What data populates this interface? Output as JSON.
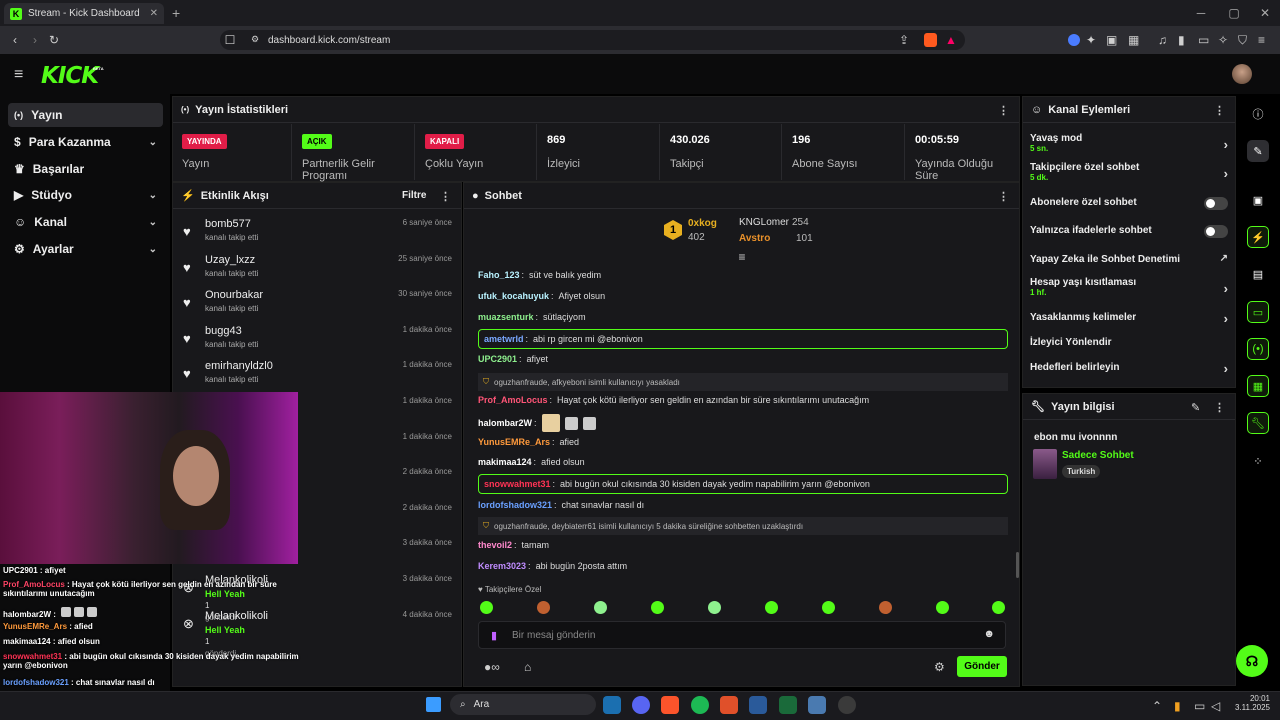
{
  "browser": {
    "tab_title": "Stream - Kick Dashboard",
    "url": "dashboard.kick.com/stream",
    "new_tab": "+"
  },
  "brand": {
    "logo": "KICK",
    "beta": "BETA",
    "accent": "#53fc18"
  },
  "sidebar": {
    "items": [
      {
        "label": "Yayın",
        "icon": "broadcast-icon",
        "active": true
      },
      {
        "label": "Para Kazanma",
        "icon": "dollar-icon",
        "chevron": true
      },
      {
        "label": "Başarılar",
        "icon": "trophy-icon"
      },
      {
        "label": "Stüdyo",
        "icon": "video-icon",
        "chevron": true
      },
      {
        "label": "Kanal",
        "icon": "users-icon",
        "chevron": true
      },
      {
        "label": "Ayarlar",
        "icon": "gear-icon",
        "chevron": true
      }
    ]
  },
  "stats": {
    "title": "Yayın İstatistikleri",
    "items": [
      {
        "value": "YAYINDA",
        "label": "Yayın",
        "badge_color": "#e11d48"
      },
      {
        "value": "AÇIK",
        "label": "Partnerlik Gelir Programı",
        "badge_color": "#53fc18"
      },
      {
        "value": "KAPALI",
        "label": "Çoklu Yayın",
        "badge_color": "#e11d48"
      },
      {
        "value": "869",
        "label": "İzleyici"
      },
      {
        "value": "430.026",
        "label": "Takipçi"
      },
      {
        "value": "196",
        "label": "Abone Sayısı"
      },
      {
        "value": "00:05:59",
        "label": "Yayında Olduğu Süre"
      }
    ]
  },
  "feed": {
    "title": "Etkinlik Akışı",
    "filter": "Filtre",
    "items": [
      {
        "name": "bomb577",
        "action": "kanalı takip etti",
        "time": "6 saniye önce"
      },
      {
        "name": "Uzay_lxzz",
        "action": "kanalı takip etti",
        "time": "25 saniye önce"
      },
      {
        "name": "Onourbakar",
        "action": "kanalı takip etti",
        "time": "30 saniye önce"
      },
      {
        "name": "bugg43",
        "action": "kanalı takip etti",
        "time": "1 dakika önce"
      },
      {
        "name": "emirhanyldzl0",
        "action": "kanalı takip etti",
        "time": "1 dakika önce"
      },
      {
        "name": "",
        "action": "",
        "time": "1 dakika önce"
      },
      {
        "name": "",
        "action": "",
        "time": "1 dakika önce"
      },
      {
        "name": "",
        "action": "",
        "time": "2 dakika önce"
      },
      {
        "name": "",
        "action": "",
        "time": "2 dakika önce"
      },
      {
        "name": "",
        "action": "",
        "time": "3 dakika önce"
      },
      {
        "name": "Melankolikoli",
        "action": "Hell Yeah",
        "extra": "1",
        "sent": "gönderdi",
        "time": "3 dakika önce"
      },
      {
        "name": "Melankolikoli",
        "action": "Hell Yeah",
        "extra": "1",
        "sent": "gönderdi",
        "time": "4 dakika önce"
      }
    ]
  },
  "chat": {
    "title": "Sohbet",
    "leaderboard": [
      {
        "rank": "1",
        "name": "0xkog",
        "count": "402"
      },
      {
        "name": "KNGLomer",
        "count": "254"
      },
      {
        "name": "Avstro",
        "count": "101"
      }
    ],
    "messages": [
      {
        "user": "Faho_123",
        "color": "#b9f2ff",
        "text": "süt ve balık yedim"
      },
      {
        "user": "ufuk_kocahuyuk",
        "color": "#b9f2ff",
        "text": "Afiyet olsun"
      },
      {
        "user": "muazsenturk",
        "color": "#8ef08e",
        "text": "sütlaçiyom"
      },
      {
        "user": "ametwrld",
        "color": "#7aa8ff",
        "text": "abi rp gircen mi @ebonivon",
        "highlight": true
      },
      {
        "user": "UPC2901",
        "color": "#8ef08e",
        "text": "afiyet"
      },
      {
        "system": true,
        "text": "oguzhanfraude, afkyeboni isimli kullanıcıyı yasakladı"
      },
      {
        "user": "Prof_AmoLocus",
        "color": "#ff5577",
        "text": "Hayat çok kötü ilerliyor sen geldin en azından bir süre sıkıntılarımı unutacağım"
      },
      {
        "user": "halombar2W",
        "color": "#fff",
        "text": ""
      },
      {
        "user": "YunusEMRe_Ars",
        "color": "#ff9a3c",
        "text": "afied"
      },
      {
        "user": "makimaa124",
        "color": "#fff",
        "text": "afied olsun"
      },
      {
        "user": "snowwahmet31",
        "color": "#ff3355",
        "text": "abi bugün okul cıkısında 30 kisiden dayak yedim napabilirim yarın @ebonivon",
        "highlight": true
      },
      {
        "user": "lordofshadow321",
        "color": "#6aa0ff",
        "text": "chat sınavlar nasıl dı"
      },
      {
        "system": true,
        "text": "oguzhanfraude, deybiaterr61 isimli kullanıcıyı 5 dakika süreliğine sohbetten uzaklaştırdı"
      },
      {
        "user": "thevoil2",
        "color": "#ff88cc",
        "text": "tamam"
      },
      {
        "user": "Kerem3023",
        "color": "#c08cff",
        "text": "abi bugün 2posta attım"
      }
    ],
    "follower_label": "Takipçilere Özel",
    "input_placeholder": "Bir mesaj gönderin",
    "send": "Gönder"
  },
  "channel_actions": {
    "title": "Kanal Eylemleri",
    "items": [
      {
        "label": "Yavaş mod",
        "sub": "5 sn.",
        "type": "arrow"
      },
      {
        "label": "Takipçilere özel sohbet",
        "sub": "5 dk.",
        "type": "arrow"
      },
      {
        "label": "Abonelere özel sohbet",
        "type": "toggle"
      },
      {
        "label": "Yalnızca ifadelerle sohbet",
        "type": "toggle"
      },
      {
        "label": "Yapay Zeka ile Sohbet Denetimi",
        "type": "external"
      },
      {
        "label": "Hesap yaşı kısıtlaması",
        "sub": "1 hf.",
        "type": "arrow"
      },
      {
        "label": "Yasaklanmış kelimeler",
        "type": "arrow"
      },
      {
        "label": "İzleyici Yönlendir",
        "type": "none"
      },
      {
        "label": "Hedefleri belirleyin",
        "type": "arrow"
      }
    ]
  },
  "stream_info": {
    "title": "Yayın bilgisi",
    "stream_title": "ebon mu ivonnnn",
    "category": "Sadece Sohbet",
    "language": "Turkish"
  },
  "overlay": [
    {
      "user": "UPC2901",
      "text": "afiyet",
      "color": "#ffffff"
    },
    {
      "user": "Prof_AmoLocus",
      "text": "Hayat çok kötü ilerliyor sen geldin en azından bir süre sıkıntılarımı unutacağım",
      "color": "#ff4466"
    },
    {
      "user": "halombar2W",
      "text": "",
      "color": "#ffffff"
    },
    {
      "user": "YunusEMRe_Ars",
      "text": "afied",
      "color": "#ff9a3c"
    },
    {
      "user": "makimaa124",
      "text": "afied olsun",
      "color": "#ffffff"
    },
    {
      "user": "snowwahmet31",
      "text": "abi bugün okul cıkısında 30 kisiden dayak yedim napabilirim yarın @ebonivon",
      "color": "#ff3355"
    },
    {
      "user": "lordofshadow321",
      "text": "chat sınavlar nasıl dı",
      "color": "#6aa0ff"
    },
    {
      "user": "thevoil2",
      "text": "tamam",
      "color": "#ffffff"
    },
    {
      "user": "Kerem3023",
      "text": "abi bugün 2posta attım",
      "color": "#ffffff"
    }
  ],
  "taskbar": {
    "search": "Ara",
    "time": "20:01",
    "date": "3.11.2025"
  }
}
